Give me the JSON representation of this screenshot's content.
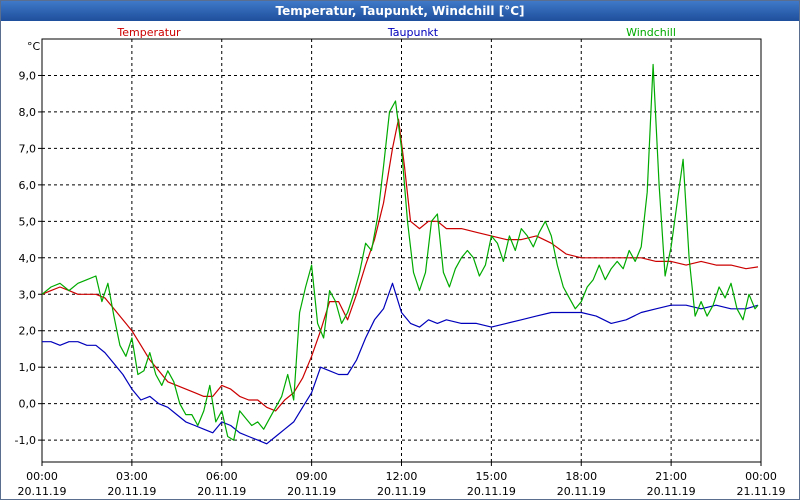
{
  "chart_data": {
    "type": "line",
    "title": "Temperatur, Taupunkt, Windchill [°C]",
    "ylabel": "°C",
    "ylim": [
      -1.6,
      10.0
    ],
    "xlim": [
      0,
      24
    ],
    "grid": true,
    "legend": "top",
    "y_ticks": [
      "-1,0",
      "0,0",
      "1,0",
      "2,0",
      "3,0",
      "4,0",
      "5,0",
      "6,0",
      "7,0",
      "8,0",
      "9,0"
    ],
    "x_ticks": [
      {
        "time": "00:00",
        "date": "20.11.19"
      },
      {
        "time": "03:00",
        "date": "20.11.19"
      },
      {
        "time": "06:00",
        "date": "20.11.19"
      },
      {
        "time": "09:00",
        "date": "20.11.19"
      },
      {
        "time": "12:00",
        "date": "20.11.19"
      },
      {
        "time": "15:00",
        "date": "20.11.19"
      },
      {
        "time": "18:00",
        "date": "20.11.19"
      },
      {
        "time": "21:00",
        "date": "20.11.19"
      },
      {
        "time": "00:00",
        "date": "21.11.19"
      }
    ],
    "series": [
      {
        "name": "Temperatur",
        "color": "#cc0000",
        "points": [
          [
            0.0,
            3.0
          ],
          [
            0.3,
            3.1
          ],
          [
            0.6,
            3.2
          ],
          [
            0.9,
            3.1
          ],
          [
            1.2,
            3.0
          ],
          [
            1.5,
            3.0
          ],
          [
            1.8,
            3.0
          ],
          [
            2.1,
            2.9
          ],
          [
            2.4,
            2.6
          ],
          [
            2.7,
            2.3
          ],
          [
            3.0,
            2.0
          ],
          [
            3.3,
            1.6
          ],
          [
            3.6,
            1.2
          ],
          [
            3.9,
            0.9
          ],
          [
            4.2,
            0.6
          ],
          [
            4.5,
            0.5
          ],
          [
            4.8,
            0.4
          ],
          [
            5.1,
            0.3
          ],
          [
            5.4,
            0.2
          ],
          [
            5.7,
            0.2
          ],
          [
            6.0,
            0.5
          ],
          [
            6.3,
            0.4
          ],
          [
            6.6,
            0.2
          ],
          [
            6.9,
            0.1
          ],
          [
            7.2,
            0.1
          ],
          [
            7.5,
            -0.1
          ],
          [
            7.8,
            -0.2
          ],
          [
            8.1,
            0.1
          ],
          [
            8.4,
            0.3
          ],
          [
            8.7,
            0.7
          ],
          [
            9.0,
            1.3
          ],
          [
            9.3,
            2.0
          ],
          [
            9.6,
            2.8
          ],
          [
            9.9,
            2.8
          ],
          [
            10.2,
            2.3
          ],
          [
            10.5,
            3.0
          ],
          [
            10.8,
            3.8
          ],
          [
            11.1,
            4.5
          ],
          [
            11.4,
            5.5
          ],
          [
            11.7,
            7.0
          ],
          [
            11.9,
            7.8
          ],
          [
            12.1,
            6.5
          ],
          [
            12.3,
            5.0
          ],
          [
            12.6,
            4.8
          ],
          [
            12.9,
            5.0
          ],
          [
            13.2,
            5.0
          ],
          [
            13.5,
            4.8
          ],
          [
            14.0,
            4.8
          ],
          [
            14.5,
            4.7
          ],
          [
            15.0,
            4.6
          ],
          [
            15.5,
            4.5
          ],
          [
            16.0,
            4.5
          ],
          [
            16.5,
            4.6
          ],
          [
            17.0,
            4.4
          ],
          [
            17.5,
            4.1
          ],
          [
            18.0,
            4.0
          ],
          [
            18.5,
            4.0
          ],
          [
            19.0,
            4.0
          ],
          [
            19.5,
            4.0
          ],
          [
            20.0,
            4.0
          ],
          [
            20.5,
            3.9
          ],
          [
            21.0,
            3.9
          ],
          [
            21.5,
            3.8
          ],
          [
            22.0,
            3.9
          ],
          [
            22.5,
            3.8
          ],
          [
            23.0,
            3.8
          ],
          [
            23.5,
            3.7
          ],
          [
            23.9,
            3.75
          ]
        ]
      },
      {
        "name": "Taupunkt",
        "color": "#0000bb",
        "points": [
          [
            0.0,
            1.7
          ],
          [
            0.3,
            1.7
          ],
          [
            0.6,
            1.6
          ],
          [
            0.9,
            1.7
          ],
          [
            1.2,
            1.7
          ],
          [
            1.5,
            1.6
          ],
          [
            1.8,
            1.6
          ],
          [
            2.1,
            1.4
          ],
          [
            2.4,
            1.1
          ],
          [
            2.7,
            0.8
          ],
          [
            3.0,
            0.4
          ],
          [
            3.3,
            0.1
          ],
          [
            3.6,
            0.2
          ],
          [
            3.9,
            0.0
          ],
          [
            4.2,
            -0.1
          ],
          [
            4.5,
            -0.3
          ],
          [
            4.8,
            -0.5
          ],
          [
            5.1,
            -0.6
          ],
          [
            5.4,
            -0.7
          ],
          [
            5.7,
            -0.8
          ],
          [
            6.0,
            -0.5
          ],
          [
            6.3,
            -0.6
          ],
          [
            6.6,
            -0.8
          ],
          [
            6.9,
            -0.9
          ],
          [
            7.2,
            -1.0
          ],
          [
            7.5,
            -1.1
          ],
          [
            7.8,
            -0.9
          ],
          [
            8.1,
            -0.7
          ],
          [
            8.4,
            -0.5
          ],
          [
            8.7,
            -0.1
          ],
          [
            9.0,
            0.3
          ],
          [
            9.3,
            1.0
          ],
          [
            9.6,
            0.9
          ],
          [
            9.9,
            0.8
          ],
          [
            10.2,
            0.8
          ],
          [
            10.5,
            1.2
          ],
          [
            10.8,
            1.8
          ],
          [
            11.1,
            2.3
          ],
          [
            11.4,
            2.6
          ],
          [
            11.7,
            3.3
          ],
          [
            12.0,
            2.5
          ],
          [
            12.3,
            2.2
          ],
          [
            12.6,
            2.1
          ],
          [
            12.9,
            2.3
          ],
          [
            13.2,
            2.2
          ],
          [
            13.5,
            2.3
          ],
          [
            14.0,
            2.2
          ],
          [
            14.5,
            2.2
          ],
          [
            15.0,
            2.1
          ],
          [
            15.5,
            2.2
          ],
          [
            16.0,
            2.3
          ],
          [
            16.5,
            2.4
          ],
          [
            17.0,
            2.5
          ],
          [
            17.5,
            2.5
          ],
          [
            18.0,
            2.5
          ],
          [
            18.5,
            2.4
          ],
          [
            19.0,
            2.2
          ],
          [
            19.5,
            2.3
          ],
          [
            20.0,
            2.5
          ],
          [
            20.5,
            2.6
          ],
          [
            21.0,
            2.7
          ],
          [
            21.5,
            2.7
          ],
          [
            22.0,
            2.6
          ],
          [
            22.5,
            2.7
          ],
          [
            23.0,
            2.6
          ],
          [
            23.5,
            2.6
          ],
          [
            23.9,
            2.7
          ]
        ]
      },
      {
        "name": "Windchill",
        "color": "#00aa00",
        "points": [
          [
            0.0,
            3.0
          ],
          [
            0.3,
            3.2
          ],
          [
            0.6,
            3.3
          ],
          [
            0.9,
            3.1
          ],
          [
            1.2,
            3.3
          ],
          [
            1.5,
            3.4
          ],
          [
            1.8,
            3.5
          ],
          [
            2.0,
            2.8
          ],
          [
            2.2,
            3.3
          ],
          [
            2.4,
            2.4
          ],
          [
            2.6,
            1.6
          ],
          [
            2.8,
            1.3
          ],
          [
            3.0,
            1.8
          ],
          [
            3.2,
            0.8
          ],
          [
            3.4,
            0.9
          ],
          [
            3.6,
            1.4
          ],
          [
            3.8,
            0.8
          ],
          [
            4.0,
            0.5
          ],
          [
            4.2,
            0.9
          ],
          [
            4.4,
            0.6
          ],
          [
            4.6,
            0.0
          ],
          [
            4.8,
            -0.3
          ],
          [
            5.0,
            -0.3
          ],
          [
            5.2,
            -0.6
          ],
          [
            5.4,
            -0.2
          ],
          [
            5.6,
            0.5
          ],
          [
            5.8,
            -0.5
          ],
          [
            6.0,
            -0.2
          ],
          [
            6.2,
            -0.9
          ],
          [
            6.4,
            -1.0
          ],
          [
            6.6,
            -0.2
          ],
          [
            6.8,
            -0.4
          ],
          [
            7.0,
            -0.6
          ],
          [
            7.2,
            -0.5
          ],
          [
            7.4,
            -0.7
          ],
          [
            7.6,
            -0.4
          ],
          [
            7.8,
            -0.1
          ],
          [
            8.0,
            0.2
          ],
          [
            8.2,
            0.8
          ],
          [
            8.4,
            0.1
          ],
          [
            8.6,
            2.5
          ],
          [
            8.8,
            3.2
          ],
          [
            9.0,
            3.8
          ],
          [
            9.2,
            2.2
          ],
          [
            9.4,
            1.8
          ],
          [
            9.6,
            3.1
          ],
          [
            9.8,
            2.8
          ],
          [
            10.0,
            2.2
          ],
          [
            10.2,
            2.5
          ],
          [
            10.4,
            3.0
          ],
          [
            10.6,
            3.6
          ],
          [
            10.8,
            4.4
          ],
          [
            11.0,
            4.2
          ],
          [
            11.2,
            5.1
          ],
          [
            11.4,
            6.5
          ],
          [
            11.6,
            8.0
          ],
          [
            11.8,
            8.3
          ],
          [
            12.0,
            7.0
          ],
          [
            12.2,
            5.0
          ],
          [
            12.4,
            3.6
          ],
          [
            12.6,
            3.1
          ],
          [
            12.8,
            3.6
          ],
          [
            13.0,
            5.0
          ],
          [
            13.2,
            5.2
          ],
          [
            13.4,
            3.6
          ],
          [
            13.6,
            3.2
          ],
          [
            13.8,
            3.7
          ],
          [
            14.0,
            4.0
          ],
          [
            14.2,
            4.2
          ],
          [
            14.4,
            4.0
          ],
          [
            14.6,
            3.5
          ],
          [
            14.8,
            3.8
          ],
          [
            15.0,
            4.6
          ],
          [
            15.2,
            4.4
          ],
          [
            15.4,
            3.9
          ],
          [
            15.6,
            4.6
          ],
          [
            15.8,
            4.2
          ],
          [
            16.0,
            4.8
          ],
          [
            16.2,
            4.6
          ],
          [
            16.4,
            4.3
          ],
          [
            16.6,
            4.7
          ],
          [
            16.8,
            5.0
          ],
          [
            17.0,
            4.6
          ],
          [
            17.2,
            3.8
          ],
          [
            17.4,
            3.2
          ],
          [
            17.6,
            2.9
          ],
          [
            17.8,
            2.6
          ],
          [
            18.0,
            2.8
          ],
          [
            18.2,
            3.2
          ],
          [
            18.4,
            3.4
          ],
          [
            18.6,
            3.8
          ],
          [
            18.8,
            3.4
          ],
          [
            19.0,
            3.7
          ],
          [
            19.2,
            3.9
          ],
          [
            19.4,
            3.7
          ],
          [
            19.6,
            4.2
          ],
          [
            19.8,
            3.9
          ],
          [
            20.0,
            4.3
          ],
          [
            20.2,
            5.8
          ],
          [
            20.4,
            9.3
          ],
          [
            20.6,
            6.0
          ],
          [
            20.8,
            3.5
          ],
          [
            21.0,
            4.3
          ],
          [
            21.2,
            5.5
          ],
          [
            21.4,
            6.7
          ],
          [
            21.6,
            4.0
          ],
          [
            21.8,
            2.4
          ],
          [
            22.0,
            2.8
          ],
          [
            22.2,
            2.4
          ],
          [
            22.4,
            2.7
          ],
          [
            22.6,
            3.2
          ],
          [
            22.8,
            2.9
          ],
          [
            23.0,
            3.3
          ],
          [
            23.2,
            2.6
          ],
          [
            23.4,
            2.3
          ],
          [
            23.6,
            3.0
          ],
          [
            23.8,
            2.6
          ],
          [
            23.9,
            2.7
          ]
        ]
      }
    ]
  }
}
